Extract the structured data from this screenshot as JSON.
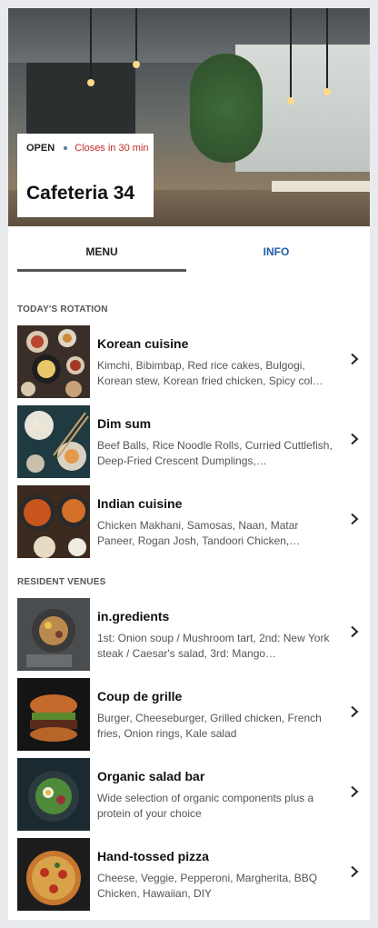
{
  "header": {
    "status": "OPEN",
    "closes": "Closes in 30 min",
    "name": "Cafeteria 34"
  },
  "tabs": {
    "menu": "MENU",
    "info": "INFO"
  },
  "sections": {
    "rotation_title": "TODAY'S ROTATION",
    "resident_title": "RESIDENT VENUES"
  },
  "rotation": [
    {
      "title": "Korean cuisine",
      "desc": "Kimchi, Bibimbap, Red rice cakes, Bulgogi, Korean stew, Korean fried chicken, Spicy col…"
    },
    {
      "title": "Dim sum",
      "desc": "Beef Balls, Rice Noodle Rolls, Curried Cuttlefish, Deep-Fried Crescent Dumplings,…"
    },
    {
      "title": "Indian cuisine",
      "desc": "Chicken Makhani, Samosas, Naan, Matar Paneer, Rogan Josh, Tandoori Chicken,…"
    }
  ],
  "resident": [
    {
      "title": "in.gredients",
      "desc": "1st: Onion soup / Mushroom tart, 2nd: New York steak / Caesar's salad, 3rd: Mango…"
    },
    {
      "title": "Coup de grille",
      "desc": "Burger, Cheeseburger, Grilled chicken, French fries, Onion rings, Kale salad"
    },
    {
      "title": "Organic salad bar",
      "desc": "Wide selection of organic components plus a protein of your choice"
    },
    {
      "title": "Hand-tossed pizza",
      "desc": "Cheese, Veggie, Pepperoni, Margherita, BBQ Chicken, Hawaiian, DIY"
    }
  ],
  "colors": {
    "closes": "#c62828",
    "info_tab": "#1f5fa8",
    "underline": "#555555"
  }
}
